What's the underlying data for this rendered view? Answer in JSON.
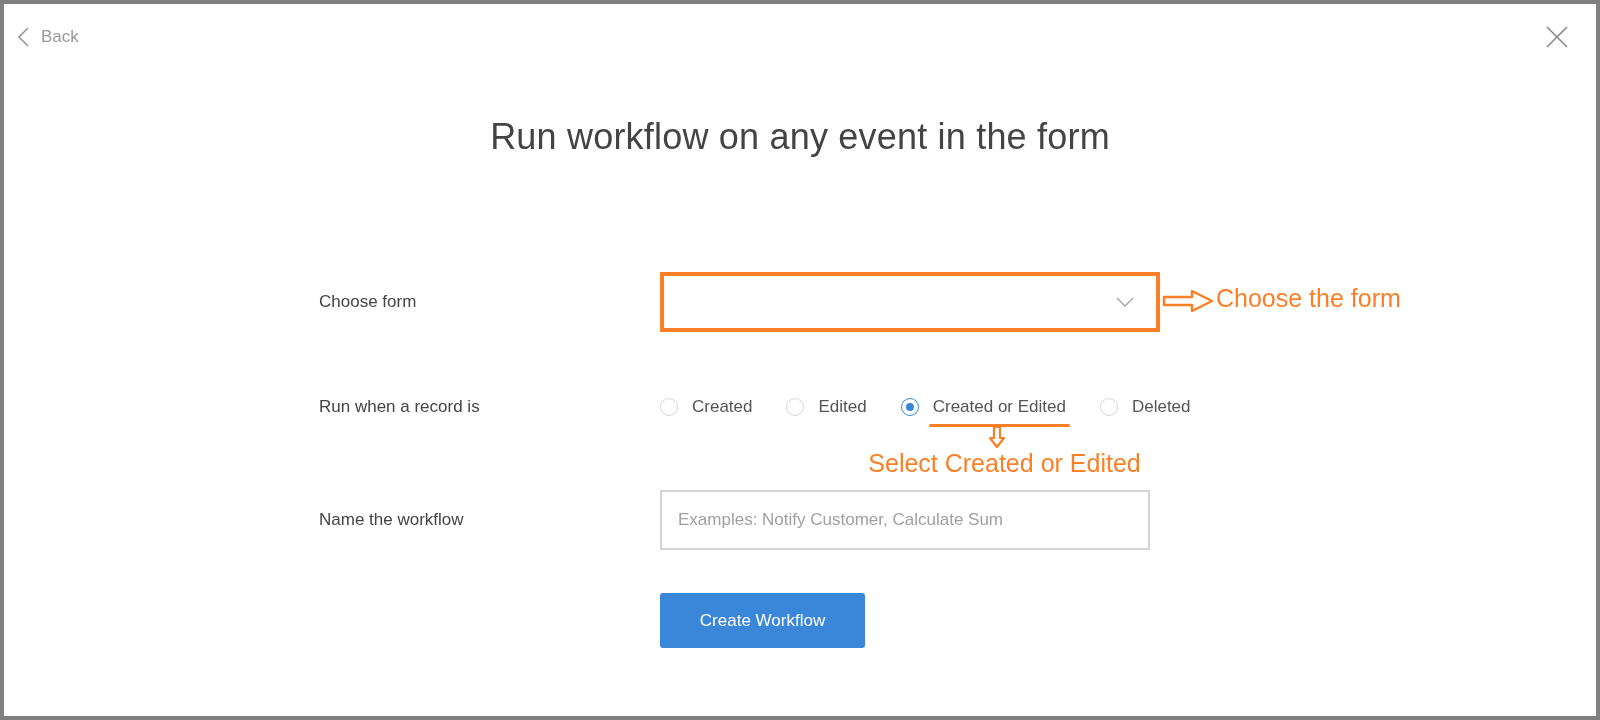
{
  "header": {
    "back_label": "Back"
  },
  "title": "Run workflow on any event in the form",
  "fields": [
    {
      "kind": "dropdown",
      "label": "Choose form",
      "annotation": "Choose the form"
    },
    {
      "kind": "radios",
      "label": "Run when a record is",
      "annotation": "Select Created or Edited",
      "options": [
        {
          "label": "Created",
          "selected": false
        },
        {
          "label": "Edited",
          "selected": false
        },
        {
          "label": "Created or Edited",
          "selected": true
        },
        {
          "label": "Deleted",
          "selected": false
        }
      ]
    },
    {
      "kind": "text",
      "label": "Name the workflow",
      "placeholder": "Examples: Notify Customer, Calculate Sum"
    }
  ],
  "submit": {
    "label": "Create Workflow"
  }
}
